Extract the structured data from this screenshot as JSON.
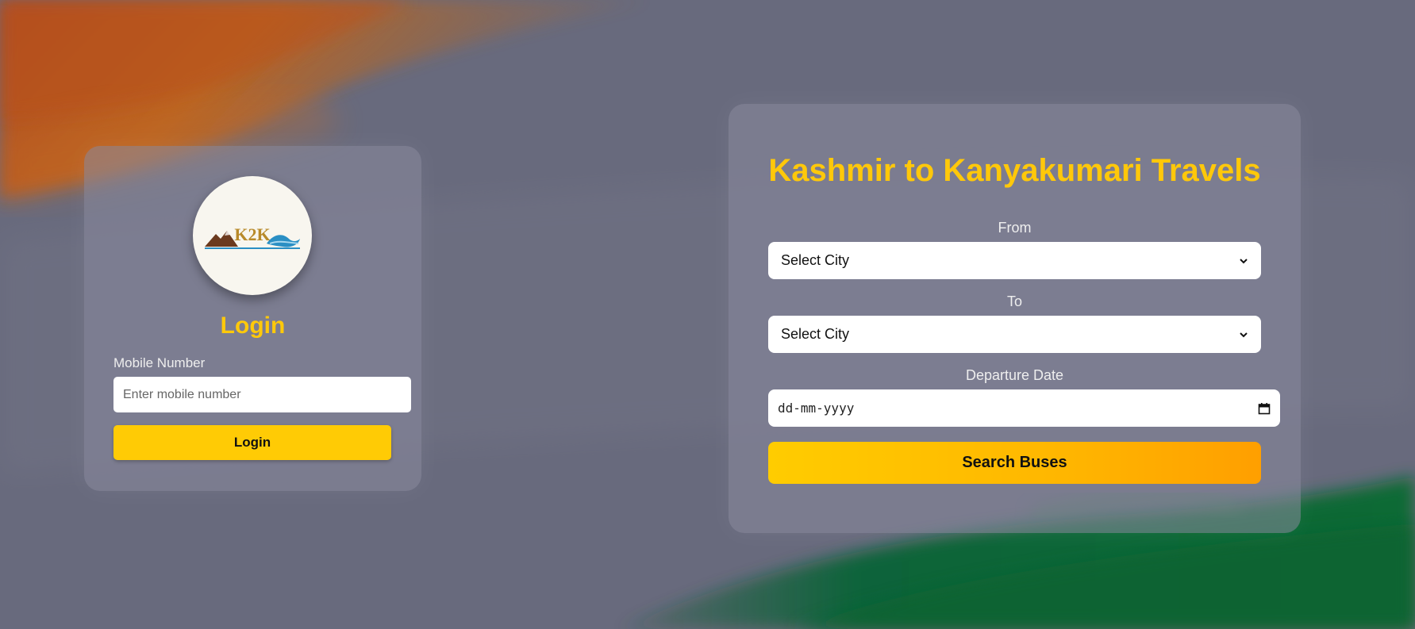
{
  "background": {
    "saffron": "#d9651c",
    "green": "#0f6b33",
    "base": "#6a6b7e"
  },
  "login": {
    "logo_text": "K2K",
    "title": "Login",
    "mobile_label": "Mobile Number",
    "mobile_placeholder": "Enter mobile number",
    "mobile_value": "",
    "button_label": "Login"
  },
  "search": {
    "title": "Kashmir to Kanyakumari Travels",
    "from_label": "From",
    "from_selected": "Select City",
    "to_label": "To",
    "to_selected": "Select City",
    "date_label": "Departure Date",
    "date_placeholder": "dd-mm-yyyy",
    "button_label": "Search Buses"
  },
  "colors": {
    "accent": "#ffc90a",
    "button_gradient_end": "#ff9f00"
  },
  "icons": {
    "select_arrow": "chevron-down-icon",
    "date_picker": "calendar-icon"
  }
}
